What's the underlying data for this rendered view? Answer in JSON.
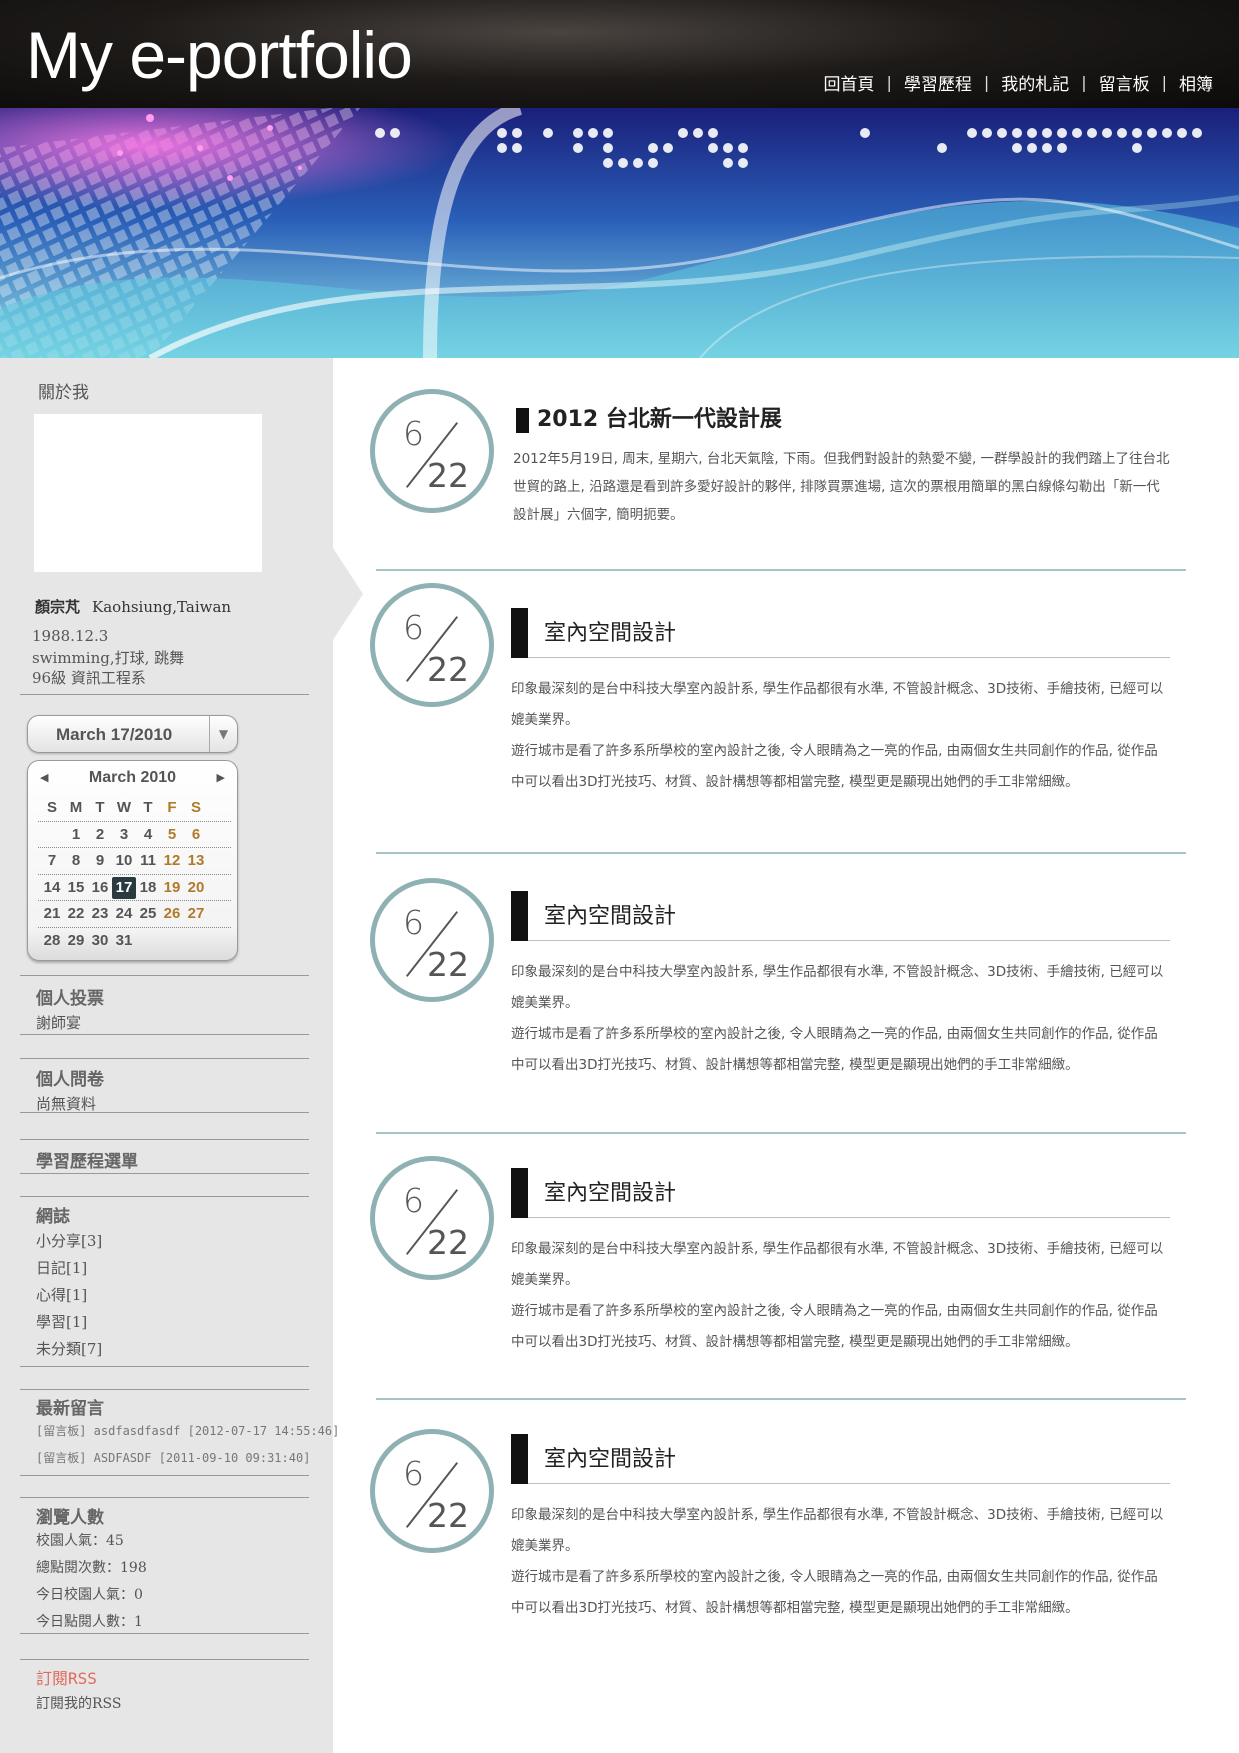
{
  "header": {
    "title": "My e-portfolio",
    "nav": [
      "回首頁",
      "學習歷程",
      "我的札記",
      "留言板",
      "相簿"
    ],
    "separator": "|"
  },
  "sidebar": {
    "about_title": "關於我",
    "profile": {
      "name": "顏宗芃",
      "location": "Kaohsiung,Taiwan",
      "birthday": "1988.12.3",
      "hobbies": "swimming,打球, 跳舞",
      "class": "96級  資訊工程系"
    },
    "calendar": {
      "selected_label": "March 17/2010",
      "month_label": "March 2010",
      "weekdays": [
        "S",
        "M",
        "T",
        "W",
        "T",
        "F",
        "S"
      ],
      "weeks": [
        [
          "",
          "1",
          "2",
          "3",
          "4",
          "5",
          "6"
        ],
        [
          "7",
          "8",
          "9",
          "10",
          "11",
          "12",
          "13"
        ],
        [
          "14",
          "15",
          "16",
          "17",
          "18",
          "19",
          "20"
        ],
        [
          "21",
          "22",
          "23",
          "24",
          "25",
          "26",
          "27"
        ],
        [
          "28",
          "29",
          "30",
          "31",
          "",
          "",
          ""
        ]
      ],
      "today": "17",
      "weekend_color": "#b07a2c"
    },
    "vote": {
      "title": "個人投票",
      "text": "謝師宴"
    },
    "survey": {
      "title": "個人問卷",
      "text": "尚無資料"
    },
    "menu": {
      "title": "學習歷程選單"
    },
    "blog": {
      "title": "網誌",
      "items": [
        "小分享[3]",
        "日記[1]",
        "心得[1]",
        "學習[1]",
        "未分類[7]"
      ]
    },
    "messages": {
      "title": "最新留言",
      "items": [
        "[留言板] asdfasdfasdf [2012-07-17 14:55:46]",
        "[留言板] ASDFASDF [2011-09-10 09:31:40]"
      ]
    },
    "stats": {
      "title": "瀏覽人數",
      "items": [
        "校園人氣：45",
        "總點閱次數：198",
        "今日校園人氣：0",
        "今日點閱人數：1"
      ]
    },
    "rss": {
      "title": "訂閱RSS",
      "text": "訂閱我的RSS"
    }
  },
  "posts": [
    {
      "month": "6",
      "day": "22",
      "title": "2012 台北新一代設計展",
      "paragraphs": [
        "2012年5月19日, 周末, 星期六, 台北天氣陰, 下雨。但我們對設計的熱愛不變, 一群學設計的我們踏上了往台北世貿的路上, 沿路還是看到許多愛好設計的夥伴, 排隊買票進場, 這次的票根用簡單的黑白線條勾勒出「新一代設計展」六個字, 簡明扼要。"
      ]
    },
    {
      "month": "6",
      "day": "22",
      "title": "室內空間設計",
      "paragraphs": [
        "印象最深刻的是台中科技大學室內設計系, 學生作品都很有水準, 不管設計概念、3D技術、手繪技術, 已經可以媲美業界。",
        "遊行城市是看了許多系所學校的室內設計之後, 令人眼睛為之一亮的作品, 由兩個女生共同創作的作品, 從作品中可以看出3D打光技巧、材質、設計構想等都相當完整, 模型更是顯現出她們的手工非常細緻。"
      ]
    },
    {
      "month": "6",
      "day": "22",
      "title": "室內空間設計",
      "paragraphs": [
        "印象最深刻的是台中科技大學室內設計系, 學生作品都很有水準, 不管設計概念、3D技術、手繪技術, 已經可以媲美業界。",
        "遊行城市是看了許多系所學校的室內設計之後, 令人眼睛為之一亮的作品, 由兩個女生共同創作的作品, 從作品中可以看出3D打光技巧、材質、設計構想等都相當完整, 模型更是顯現出她們的手工非常細緻。"
      ]
    },
    {
      "month": "6",
      "day": "22",
      "title": "室內空間設計",
      "paragraphs": [
        "印象最深刻的是台中科技大學室內設計系, 學生作品都很有水準, 不管設計概念、3D技術、手繪技術, 已經可以媲美業界。",
        "遊行城市是看了許多系所學校的室內設計之後, 令人眼睛為之一亮的作品, 由兩個女生共同創作的作品, 從作品中可以看出3D打光技巧、材質、設計構想等都相當完整, 模型更是顯現出她們的手工非常細緻。"
      ]
    },
    {
      "month": "6",
      "day": "22",
      "title": "室內空間設計",
      "paragraphs": [
        "印象最深刻的是台中科技大學室內設計系, 學生作品都很有水準, 不管設計概念、3D技術、手繪技術, 已經可以媲美業界。",
        "遊行城市是看了許多系所學校的室內設計之後, 令人眼睛為之一亮的作品, 由兩個女生共同創作的作品, 從作品中可以看出3D打光技巧、材質、設計構想等都相當完整, 模型更是顯現出她們的手工非常細緻。"
      ]
    }
  ],
  "colors": {
    "circle_border": "#8fb1b4",
    "divider": "#a7c3c5",
    "sidebar_bg": "#e6e6e6",
    "rss": "#e06a5c"
  }
}
